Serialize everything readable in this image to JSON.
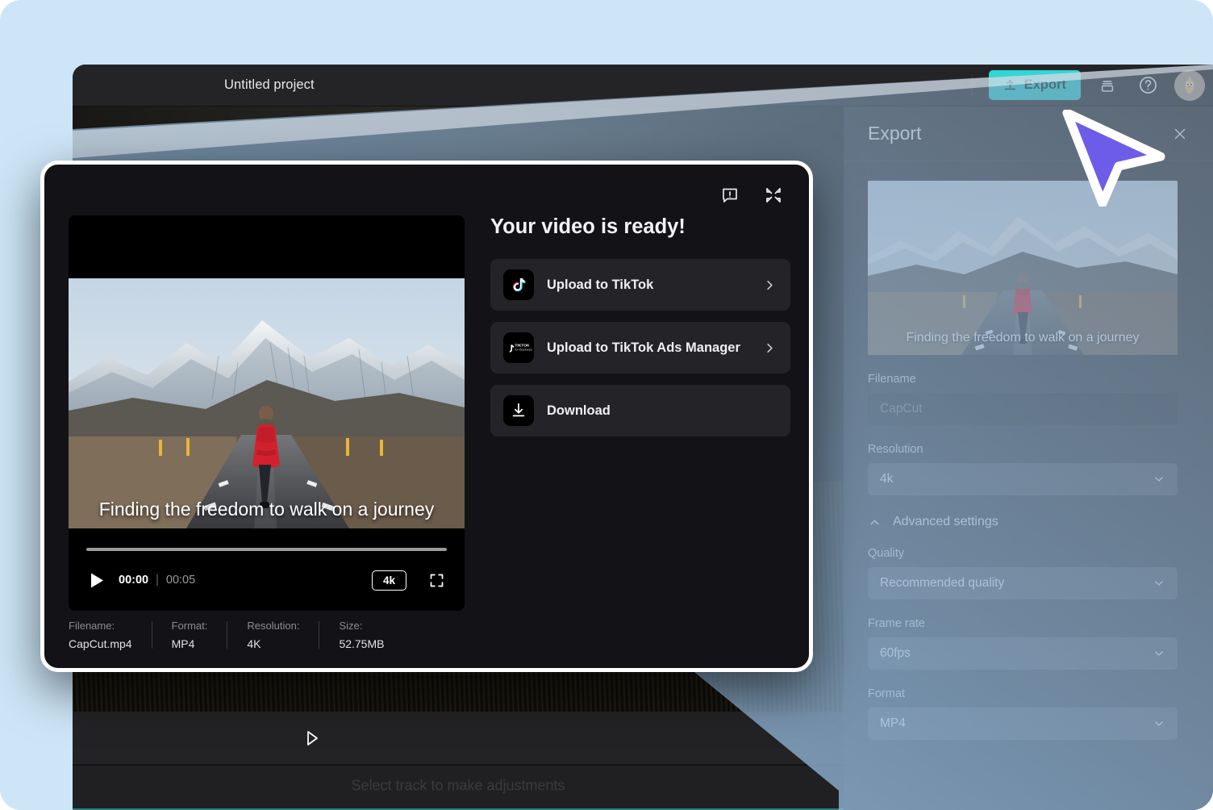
{
  "colors": {
    "page_background": "#cde6f7",
    "accent_teal": "#2fd8d8",
    "cursor_purple": "#6c5ce7",
    "panel_background": "#2b2b2f",
    "modal_background": "#131317",
    "modal_border": "#ffffff"
  },
  "topbar": {
    "project_title": "Untitled project",
    "export_label": "Export",
    "icons": {
      "upload": "upload-icon",
      "layers": "layers-icon",
      "help": "help-icon",
      "avatar": "avatar"
    }
  },
  "editor": {
    "timeline_hint": "Select track to make adjustments",
    "play_icon": "play-outline-icon"
  },
  "export_panel": {
    "title": "Export",
    "close_icon": "close-icon",
    "thumbnail_caption": "Finding the freedom to walk on a journey",
    "fields": {
      "filename": {
        "label": "Filename",
        "value": "CapCut",
        "placeholder": "CapCut"
      },
      "resolution": {
        "label": "Resolution",
        "value": "4k"
      },
      "quality": {
        "label": "Quality",
        "value": "Recommended quality"
      },
      "frame_rate": {
        "label": "Frame rate",
        "value": "60fps"
      },
      "format": {
        "label": "Format",
        "value": "MP4"
      }
    },
    "advanced_settings": {
      "label": "Advanced settings",
      "icon": "chevron-up-icon",
      "expanded": true
    }
  },
  "ready_modal": {
    "heading": "Your video is ready!",
    "report_icon": "report-feedback-icon",
    "minimize_icon": "minimize-icon",
    "player": {
      "caption": "Finding the freedom to walk on a journey",
      "play_icon": "play-icon",
      "current_time": "00:00",
      "time_separator": "|",
      "total_time": "00:05",
      "quality_badge": "4k",
      "fullscreen_icon": "fullscreen-icon",
      "progress_percent": 0
    },
    "actions": [
      {
        "label": "Upload to TikTok",
        "icon": "tiktok-icon",
        "has_chevron": true
      },
      {
        "label": "Upload to TikTok Ads Manager",
        "icon": "tiktok-for-business-icon",
        "has_chevron": true
      },
      {
        "label": "Download",
        "icon": "download-icon",
        "has_chevron": false
      }
    ],
    "metadata": [
      {
        "key": "Filename:",
        "value": "CapCut.mp4"
      },
      {
        "key": "Format:",
        "value": "MP4"
      },
      {
        "key": "Resolution:",
        "value": "4K"
      },
      {
        "key": "Size:",
        "value": "52.75MB"
      }
    ]
  },
  "cursor": {
    "icon": "mouse-pointer-icon"
  }
}
